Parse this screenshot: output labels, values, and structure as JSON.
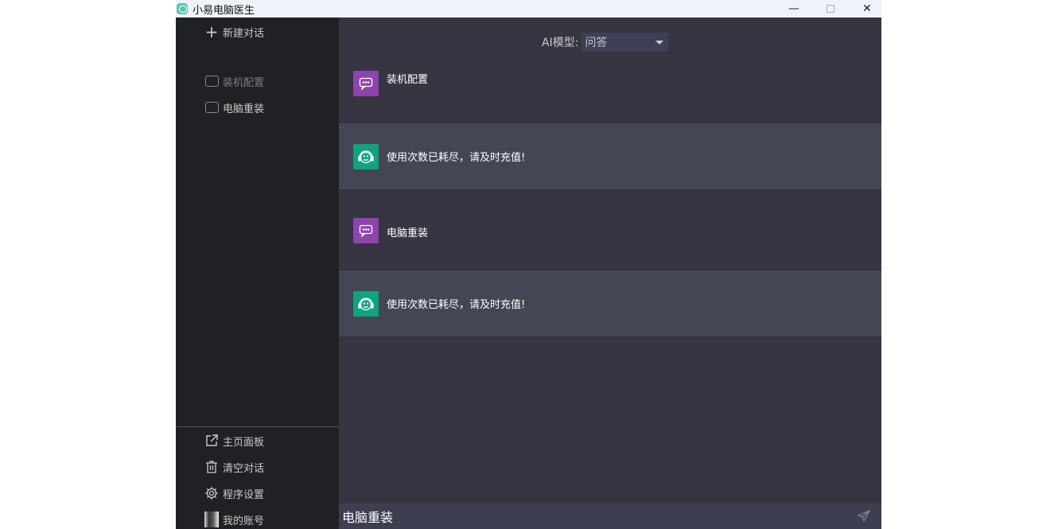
{
  "window": {
    "title": "小易电脑医生"
  },
  "sidebar": {
    "new_chat": "新建对话",
    "history": [
      {
        "label": "装机配置"
      },
      {
        "label": "电脑重装"
      }
    ],
    "bottom": [
      {
        "label": "主页面板"
      },
      {
        "label": "清空对话"
      },
      {
        "label": "程序设置"
      },
      {
        "label": "我的账号"
      }
    ]
  },
  "main": {
    "model_label": "AI模型:",
    "model_value": "问答",
    "messages": [
      {
        "role": "user",
        "text": "装机配置"
      },
      {
        "role": "bot",
        "text": "使用次数已耗尽，请及时充值!"
      },
      {
        "role": "user",
        "text": "电脑重装"
      },
      {
        "role": "bot",
        "text": "使用次数已耗尽，请及时充值!"
      }
    ],
    "input_value": "电脑重装"
  },
  "colors": {
    "user_avatar": "#8e44ad",
    "bot_avatar": "#10a37f"
  }
}
